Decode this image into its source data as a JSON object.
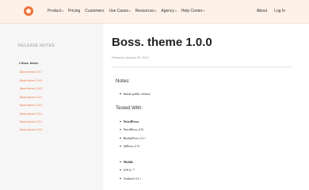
{
  "header": {
    "nav": [
      {
        "label": "Product",
        "dropdown": true
      },
      {
        "label": "Pricing",
        "dropdown": false
      },
      {
        "label": "Customers",
        "dropdown": false
      },
      {
        "label": "Use Cases",
        "dropdown": true
      },
      {
        "label": "Resources",
        "dropdown": true
      },
      {
        "label": "Agency",
        "dropdown": true
      },
      {
        "label": "Help Center",
        "dropdown": true
      }
    ],
    "right": [
      "About",
      "Log In"
    ],
    "caret": "▾"
  },
  "sidebar": {
    "title": "RELEASE NOTES",
    "active_marker": "▾",
    "items": [
      {
        "label": "Boss. theme",
        "active": true
      },
      {
        "label": "Boss theme 2.5.7",
        "active": false
      },
      {
        "label": "Boss theme 2.5.6",
        "active": false
      },
      {
        "label": "Boss theme 2.5.5",
        "active": false
      },
      {
        "label": "Boss theme 2.5.4",
        "active": false
      },
      {
        "label": "Boss theme 2.5.3",
        "active": false
      },
      {
        "label": "Boss theme 2.5.2",
        "active": false
      },
      {
        "label": "Boss theme 2.5.1",
        "active": false
      },
      {
        "label": "Boss theme 2.5.0",
        "active": false
      }
    ]
  },
  "main": {
    "title": "Boss. theme 1.0.0",
    "release_date": "Released January 25, 2019",
    "notes_heading": "Notes:",
    "notes": [
      "Initial public release"
    ],
    "tested_heading": "Tested With:",
    "tested": [
      {
        "label": "WordPress",
        "bold": true
      },
      {
        "label": "WordPress 4.9+",
        "bold": false
      },
      {
        "label": "BuddyPress 2.1+",
        "bold": false
      },
      {
        "label": "bbPress 2.5+",
        "bold": false
      },
      {
        "label": "Mobile",
        "bold": true
      },
      {
        "label": "iOS 6, 7",
        "bold": false
      },
      {
        "label": "Android 4.1+",
        "bold": false
      }
    ]
  },
  "colors": {
    "accent": "#f0703a",
    "header_bg": "#fdf1e8",
    "sidebar_bg": "#f6f6f6"
  }
}
